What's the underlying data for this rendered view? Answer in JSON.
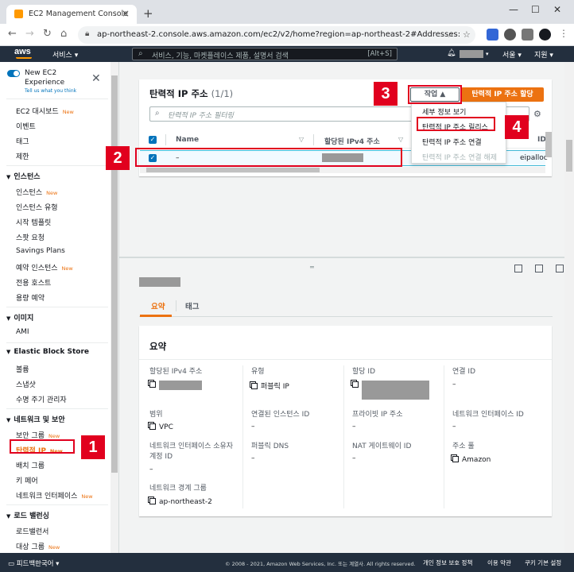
{
  "browser": {
    "tab_title": "EC2 Management Console",
    "url": "ap-northeast-2.console.aws.amazon.com/ec2/v2/home?region=ap-northeast-2#Addresses:"
  },
  "awsnav": {
    "logo": "aws",
    "services": "서비스",
    "search_placeholder": "서비스, 기능, 마켓플레이스 제품, 설명서 검색",
    "search_shortcut": "[Alt+S]",
    "region": "서울",
    "support": "지원"
  },
  "sidebar": {
    "new_ec2": "New EC2 Experience",
    "tell_us": "Tell us what you think",
    "new_badge": "New",
    "top_items": [
      "EC2 대시보드",
      "이벤트",
      "태그",
      "제한"
    ],
    "sections": [
      {
        "title": "인스턴스",
        "items": [
          "인스턴스",
          "인스턴스 유형",
          "시작 템플릿",
          "스팟 요청",
          "Savings Plans",
          "예약 인스턴스",
          "전용 호스트",
          "용량 예약"
        ]
      },
      {
        "title": "이미지",
        "items": [
          "AMI"
        ]
      },
      {
        "title": "Elastic Block Store",
        "items": [
          "볼륨",
          "스냅샷",
          "수명 주기 관리자"
        ]
      },
      {
        "title": "네트워크 및 보안",
        "items": [
          "보안 그룹",
          "탄력적 IP",
          "배치 그룹",
          "키 페어",
          "네트워크 인터페이스"
        ]
      },
      {
        "title": "로드 밸런싱",
        "items": [
          "로드밸런서",
          "대상 그룹"
        ]
      }
    ]
  },
  "panel": {
    "title": "탄력적 IP 주소",
    "count": "(1/1)",
    "filter_placeholder": "탄력적 IP 주소 필터링",
    "action_label": "작업",
    "allocate_label": "탄력적 IP 주소 할당",
    "columns": [
      "Name",
      "할당된 IPv4 주소",
      "ID"
    ],
    "row": {
      "name": "–",
      "id": "eipalloc"
    },
    "menu": [
      {
        "label": "세부 정보 보기",
        "disabled": false
      },
      {
        "label": "탄력적 IP 주소 릴리스",
        "disabled": false
      },
      {
        "label": "탄력적 IP 주소 연결",
        "disabled": false
      },
      {
        "label": "탄력적 IP 주소 연결 해제",
        "disabled": true
      }
    ]
  },
  "detail": {
    "tabs": [
      "요약",
      "태그"
    ],
    "summary_title": "요약",
    "fields": [
      {
        "label": "할당된 IPv4 주소",
        "value": ""
      },
      {
        "label": "유형",
        "value": "퍼블릭 IP"
      },
      {
        "label": "할당 ID",
        "value": ""
      },
      {
        "label": "연결 ID",
        "value": "–"
      },
      {
        "label": "범위",
        "value": "VPC"
      },
      {
        "label": "연결된 인스턴스 ID",
        "value": "–"
      },
      {
        "label": "프라이빗 IP 주소",
        "value": "–"
      },
      {
        "label": "네트워크 인터페이스 ID",
        "value": "–"
      },
      {
        "label": "네트워크 인터페이스 소유자 계정 ID",
        "value": "–"
      },
      {
        "label": "퍼블릭 DNS",
        "value": "–"
      },
      {
        "label": "NAT 게이트웨이 ID",
        "value": "–"
      },
      {
        "label": "주소 풀",
        "value": "Amazon"
      },
      {
        "label": "네트워크 경계 그룹",
        "value": "ap-northeast-2"
      }
    ]
  },
  "footer": {
    "feedback": "피드백",
    "language": "한국어",
    "copyright": "© 2008 - 2021, Amazon Web Services, Inc. 또는 계열사. All rights reserved.",
    "privacy": "개인 정보 보호 정책",
    "terms": "이용 약관",
    "cookies": "쿠키 기본 설정"
  },
  "annotations": [
    "1",
    "2",
    "3",
    "4"
  ],
  "colors": {
    "aws_dark": "#232f3e",
    "orange": "#ec7211",
    "annotation_red": "#e1001e",
    "link_blue": "#0073bb"
  }
}
